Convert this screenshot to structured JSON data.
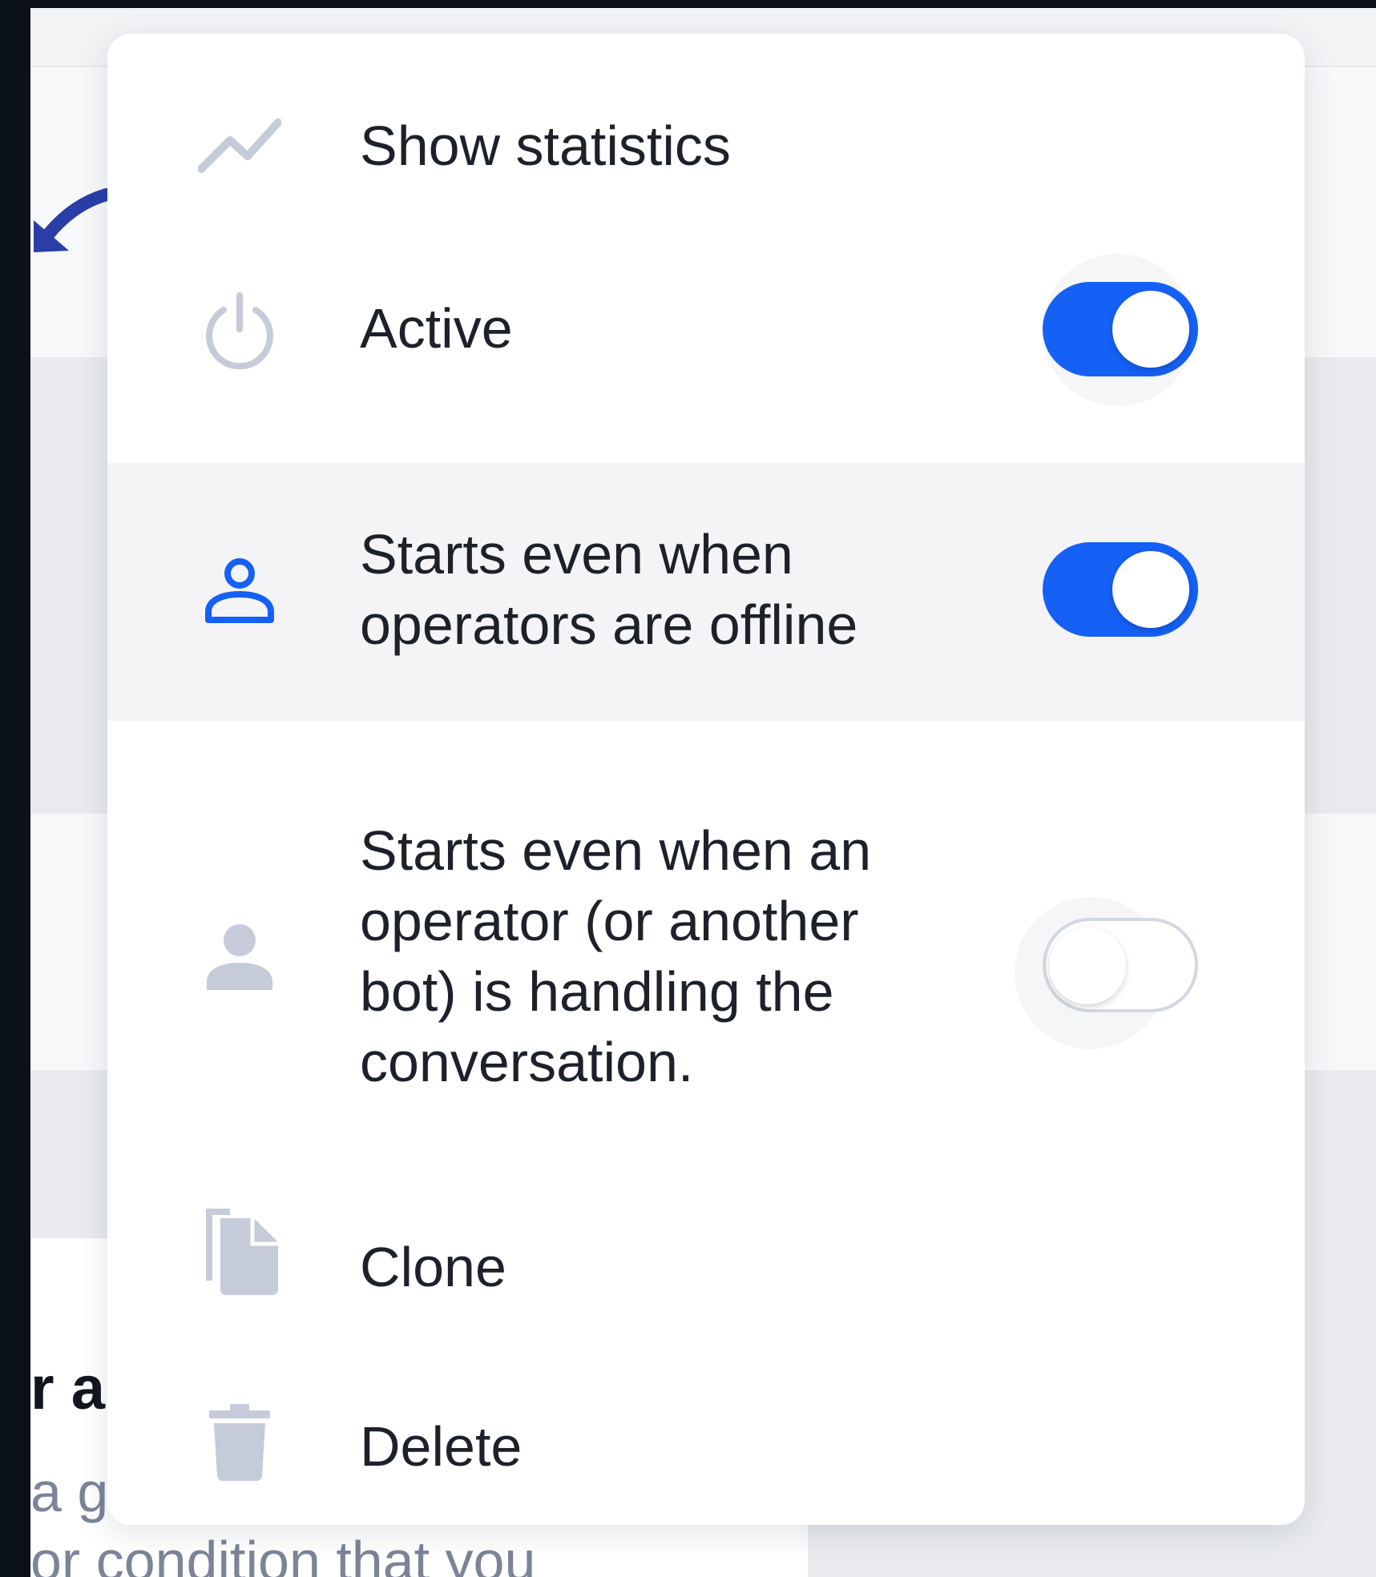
{
  "background": {
    "heading_fragment": "r a",
    "text_fragment_1": "a g",
    "text_fragment_2": "or condition that you"
  },
  "menu": {
    "items": [
      {
        "label": "Show statistics",
        "icon": "trend-line-icon"
      },
      {
        "label": "Active",
        "icon": "power-icon",
        "toggle": true
      },
      {
        "label": "Starts even when operators are offline",
        "icon": "user-outline-icon",
        "toggle": true
      },
      {
        "label": "Starts even when an operator (or another bot) is handling the conversation.",
        "icon": "user-filled-icon",
        "toggle": false
      },
      {
        "label": "Clone",
        "icon": "copy-icon"
      },
      {
        "label": "Delete",
        "icon": "trash-icon"
      }
    ]
  },
  "colors": {
    "accent": "#1560f5",
    "icon_muted": "#c5cbd9",
    "text": "#1d2129"
  }
}
